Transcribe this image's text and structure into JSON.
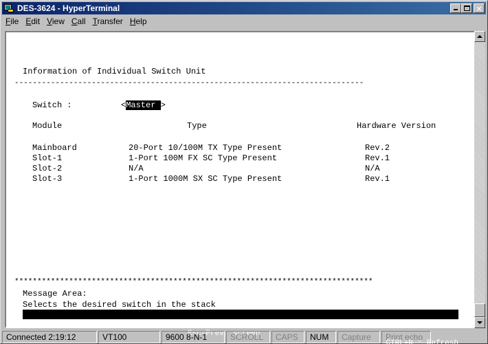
{
  "window": {
    "title": "DES-3624 - HyperTerminal"
  },
  "menu": [
    {
      "label": "File",
      "u": "F",
      "rest": "ile"
    },
    {
      "label": "Edit",
      "u": "E",
      "rest": "dit"
    },
    {
      "label": "View",
      "u": "V",
      "rest": "iew"
    },
    {
      "label": "Call",
      "u": "C",
      "rest": "all"
    },
    {
      "label": "Transfer",
      "u": "T",
      "rest": "ransfer"
    },
    {
      "label": "Help",
      "u": "H",
      "rest": "elp"
    }
  ],
  "terminal": {
    "heading": "Information of Individual Switch Unit",
    "dash_line": "-----------------------------------------------------------------------------",
    "switch_label": "Switch :",
    "switch_value": "Master",
    "columns": {
      "module": "Module",
      "type": "Type",
      "hw": "Hardware Version"
    },
    "rows": [
      {
        "module": "Mainboard",
        "type": "20-Port 10/100M TX Type Present",
        "hw": "Rev.2"
      },
      {
        "module": "Slot-1",
        "type": "1-Port 100M FX SC Type Present",
        "hw": "Rev.1"
      },
      {
        "module": "Slot-2",
        "type": "N/A",
        "hw": "N/A"
      },
      {
        "module": "Slot-3",
        "type": "1-Port 1000M SX SC Type Present",
        "hw": "Rev.1"
      }
    ],
    "star_line": "*******************************************************************************",
    "message_area_label": "Message Area:",
    "message_text": "Selects the desired switch in the stack",
    "footer": {
      "root": "CTRL+T=Root screen",
      "prev": "Esc=Prev. screen",
      "refresh": "CTRL+R = Refresh"
    }
  },
  "statusbar": {
    "connected": "Connected 2:19:12",
    "emulation": "VT100",
    "port": "9600 8-N-1",
    "scroll": "SCROLL",
    "caps": "CAPS",
    "num": "NUM",
    "capture": "Capture",
    "print": "Print echo"
  },
  "colors": {
    "titlebar_start": "#0a246a",
    "titlebar_end": "#3a6ea5",
    "chrome": "#c0c0c0"
  }
}
